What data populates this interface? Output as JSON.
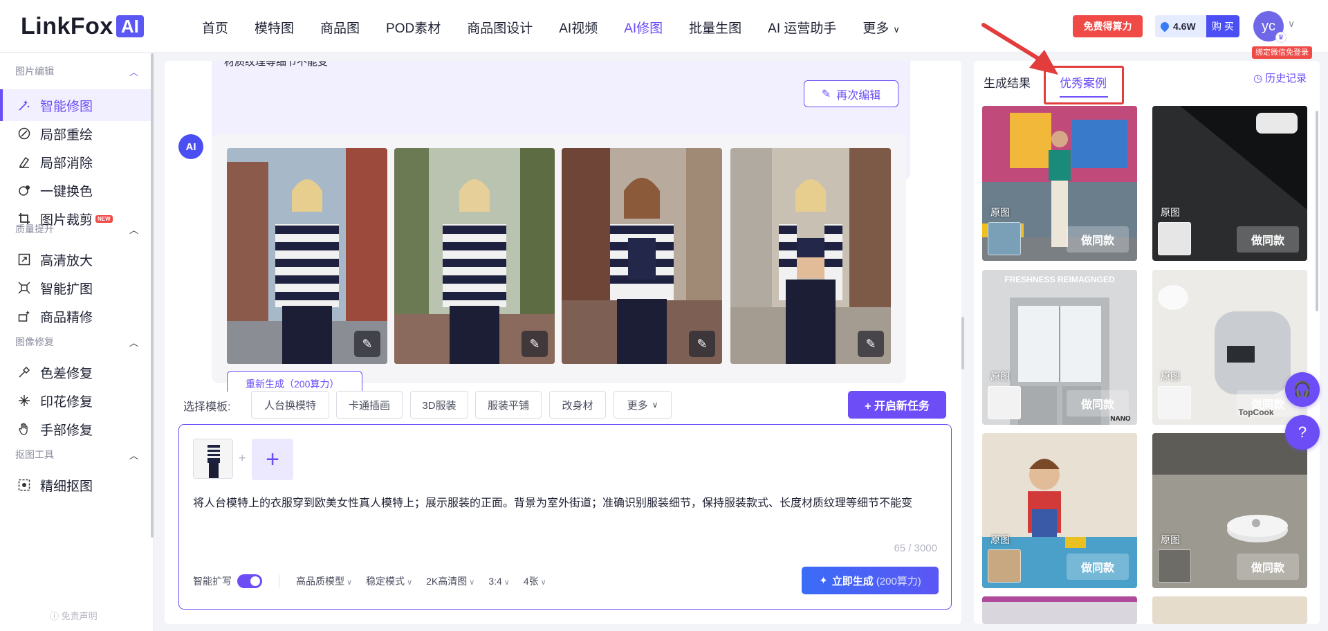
{
  "brand": {
    "logo_text": "LinkFox",
    "logo_badge": "AI",
    "accent": "#6c4df6"
  },
  "nav": {
    "items": [
      "首页",
      "模特图",
      "商品图",
      "POD素材",
      "商品图设计",
      "AI视频",
      "AI修图",
      "批量生图",
      "AI 运营助手",
      "更多"
    ],
    "active": "AI修图"
  },
  "header": {
    "free_btn": "免费得算力",
    "balance": "4.6W",
    "buy_btn": "购 买",
    "avatar_text": "yc",
    "bind_tag": "绑定微信免登录"
  },
  "sidebar": {
    "groups": [
      {
        "title": "图片编辑",
        "items": [
          "智能修图",
          "局部重绘",
          "局部消除",
          "一键换色",
          "图片裁剪"
        ]
      },
      {
        "title": "质量提升",
        "items": [
          "高清放大",
          "智能扩图",
          "商品精修"
        ]
      },
      {
        "title": "图像修复",
        "items": [
          "色差修复",
          "印花修复",
          "手部修复"
        ]
      },
      {
        "title": "抠图工具",
        "items": [
          "精细抠图"
        ]
      }
    ],
    "active_item": "智能修图",
    "new_badge": "NEW",
    "footer": "免责声明"
  },
  "chat": {
    "user_text_tail": "材质纹理等细节不能变",
    "reedit_btn": "再次编辑",
    "ai_badge": "AI",
    "regen_btn": "重新生成（200算力）"
  },
  "templates": {
    "label": "选择模板:",
    "chips": [
      "人台换模特",
      "卡通插画",
      "3D服装",
      "服装平铺",
      "改身材",
      "更多"
    ],
    "new_task_btn": "+ 开启新任务"
  },
  "composer": {
    "prompt": "将人台模特上的衣服穿到欧美女性真人模特上；展示服装的正面。背景为室外街道；准确识别服装细节，保持服装款式、长度材质纹理等细节不能变",
    "counter": "65 / 3000",
    "smart_expand_label": "智能扩写",
    "smart_expand_on": true,
    "options": [
      "高品质模型",
      "稳定模式",
      "2K高清图",
      "3:4",
      "4张"
    ],
    "generate_btn": "立即生成",
    "generate_cost": "(200算力)"
  },
  "right_panel": {
    "tabs": [
      "生成结果",
      "优秀案例"
    ],
    "active_tab": "优秀案例",
    "history": "历史记录",
    "case_orig_label": "原图",
    "case_same_btn": "做同款",
    "case_texts": [
      "FRESHNESS REIMAGNGED",
      "NANO",
      "TopCook"
    ]
  }
}
